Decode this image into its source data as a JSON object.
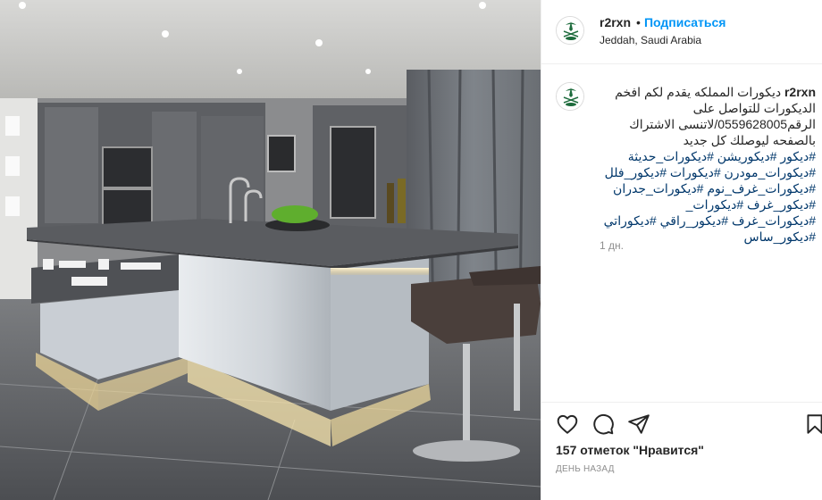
{
  "post": {
    "username": "r2rxn",
    "separator": "•",
    "follow_label": "Подписаться",
    "location": "Jeddah, Saudi Arabia"
  },
  "caption": {
    "username": "r2rxn",
    "text": "ديكورات المملكه يقدم لكم افخم الديكورات للتواصل على الرقم0559628005/لاتنسى الاشتراك بالصفحه ليوصلك كل جديد",
    "hashtags": "#ديكور #ديكوريشن #ديكورات_حديثة #ديكورات_مودرن #ديكورات #ديكور_فلل #ديكورات_غرف_نوم #ديكورات_جدران #ديكور_غرف #ديكورات_ #ديكورات_غرف #ديكور_راقي #ديكوراتي #ديكور_ساس",
    "time_ago": "1 дн."
  },
  "actions": {
    "like_icon": "heart-outline-icon",
    "comment_icon": "comment-bubble-icon",
    "share_icon": "paper-plane-icon",
    "save_icon": "bookmark-icon"
  },
  "stats": {
    "likes_text": "157 отметок \"Нравится\"",
    "date_text": "ДЕНЬ НАЗАД"
  },
  "colors": {
    "link_blue": "#0095f6",
    "hashtag_blue": "#00376b",
    "muted_gray": "#8e8e8e",
    "border": "#efefef",
    "logo_green": "#1d6b3c"
  }
}
